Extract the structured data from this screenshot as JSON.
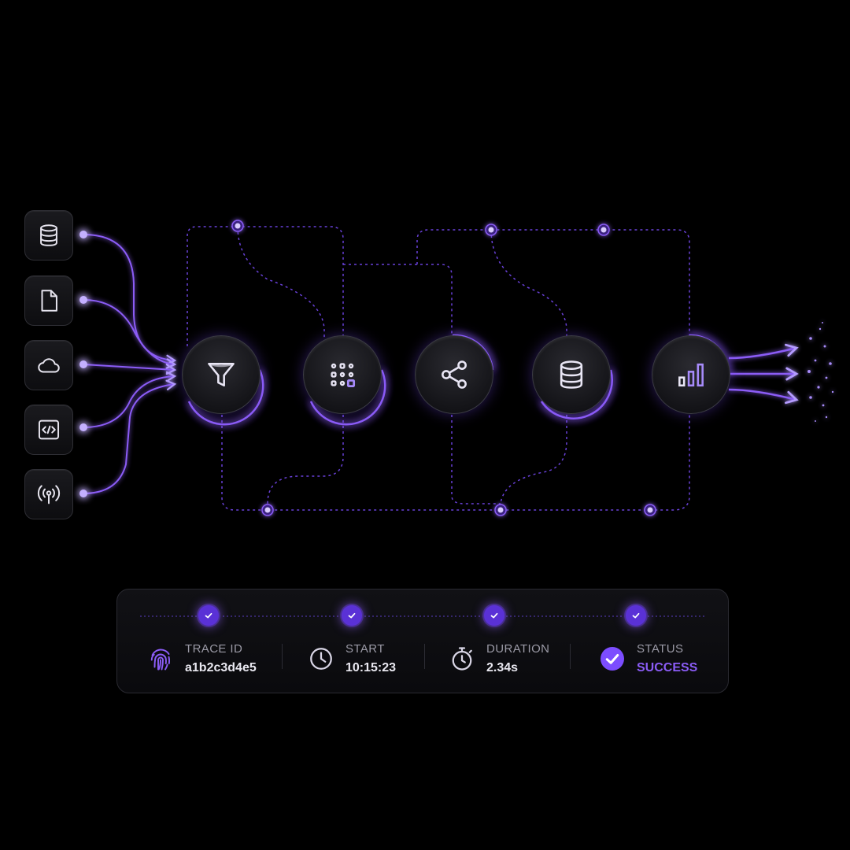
{
  "colors": {
    "accent": "#8b5cf6",
    "accent_bright": "#a78bfa",
    "background": "#000000",
    "panel": "#0e0e12"
  },
  "sources": [
    {
      "icon": "database-icon"
    },
    {
      "icon": "file-icon"
    },
    {
      "icon": "cloud-icon"
    },
    {
      "icon": "code-icon"
    },
    {
      "icon": "broadcast-icon"
    }
  ],
  "pipeline": [
    {
      "icon": "filter-icon"
    },
    {
      "icon": "qr-grid-icon"
    },
    {
      "icon": "share-icon"
    },
    {
      "icon": "database-icon"
    },
    {
      "icon": "bar-chart-icon"
    }
  ],
  "trace": {
    "trace_id_label": "TRACE ID",
    "trace_id_value": "a1b2c3d4e5",
    "start_label": "START",
    "start_value": "10:15:23",
    "duration_label": "DURATION",
    "duration_value": "2.34s",
    "status_label": "STATUS",
    "status_value": "SUCCESS"
  }
}
